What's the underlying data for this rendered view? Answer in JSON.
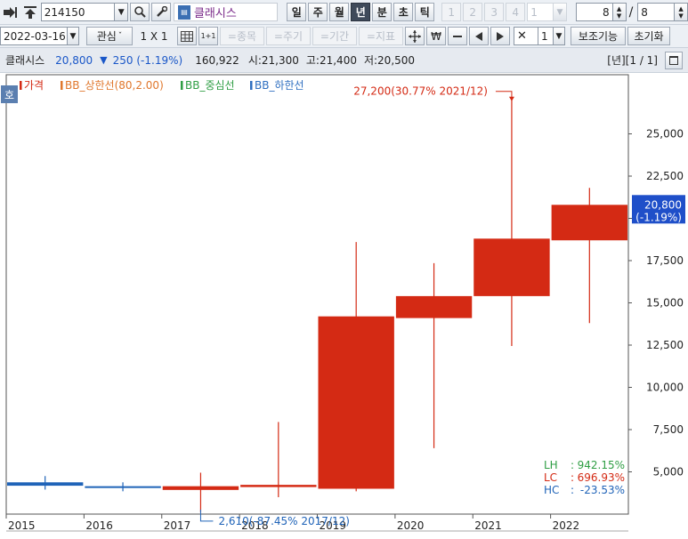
{
  "toolbar1": {
    "code": "214150",
    "stock_name": "클래시스",
    "periods": [
      "일",
      "주",
      "월",
      "년",
      "분",
      "초",
      "틱"
    ],
    "selected_period": "년",
    "split_numbers": [
      "1",
      "2",
      "3",
      "4"
    ],
    "split_input": "1",
    "page_value": "8",
    "page_separator": "/",
    "page_total": "8"
  },
  "toolbar2": {
    "date": "2022-03-16",
    "interest_label": "관심",
    "layout_label": "1 X 1",
    "grid_small_label": "1+1",
    "item_label": "=종목",
    "cycle_label": "=주기",
    "period_label": "=기간",
    "indicator_label": "=지표",
    "won_label": "₩",
    "count_value": "1",
    "aux_label": "보조기능",
    "reset_label": "초기화"
  },
  "status": {
    "name": "클래시스",
    "price": "20,800",
    "direction": "▼",
    "change": "250 (-1.19%)",
    "volume": "160,922",
    "open": "시:21,300",
    "high": "고:21,400",
    "low": "저:20,500",
    "page_info": "[년][1 / 1]"
  },
  "colors": {
    "up": "#d42a14",
    "down": "#1f63b8",
    "legend_price": "#d42a14",
    "legend_bb_upper": "#e0772c",
    "legend_bb_mid": "#2f9e44",
    "legend_bb_lower": "#2f6fc0",
    "last_price_box": "#1f4fc9"
  },
  "icons": [
    "arrow-in-icon",
    "stack-icon",
    "search-icon",
    "wrench-icon",
    "grid-icon",
    "crosshair-icon",
    "scroll-left-icon",
    "scroll-right-icon",
    "fullscreen-icon"
  ],
  "chart_data": {
    "type": "candlestick",
    "x": [
      "2015",
      "2016",
      "2017",
      "2018",
      "2019",
      "2020",
      "2021",
      "2022"
    ],
    "candles": [
      {
        "x": "2015",
        "open": 4380,
        "high": 4750,
        "low": 3950,
        "close": 4180
      },
      {
        "x": "2016",
        "open": 4150,
        "high": 4380,
        "low": 3850,
        "close": 4070
      },
      {
        "x": "2017",
        "open": 3930,
        "high": 4950,
        "low": 2610,
        "close": 4150
      },
      {
        "x": "2018",
        "open": 4100,
        "high": 7950,
        "low": 3500,
        "close": 4230
      },
      {
        "x": "2019",
        "open": 4000,
        "high": 18600,
        "low": 3850,
        "close": 14200
      },
      {
        "x": "2020",
        "open": 14100,
        "high": 17350,
        "low": 6400,
        "close": 15400
      },
      {
        "x": "2021",
        "open": 15400,
        "high": 27200,
        "low": 12450,
        "close": 18800
      },
      {
        "x": "2022",
        "open": 18700,
        "high": 21800,
        "low": 13800,
        "close": 20800
      }
    ],
    "ylim": [
      2500,
      28500
    ],
    "yticks": [
      "5,000",
      "7,500",
      "10,000",
      "12,500",
      "15,000",
      "17,500",
      "20,000",
      "22,500",
      "25,000"
    ],
    "legend": [
      "가격",
      "BB_상한선(80,2.00)",
      "BB_중심선",
      "BB_하한선"
    ],
    "legend_placement": "top-left",
    "max_annotation": "27,200(30.77% 2021/12)",
    "min_annotation": "2,610(-87.45% 2017/12)",
    "last_price_label": "20,800",
    "last_change_label": "(-1.19%)",
    "stats": [
      {
        "key": "LH",
        "sep": ":",
        "value": "942.15%"
      },
      {
        "key": "LC",
        "sep": ":",
        "value": "696.93%"
      },
      {
        "key": "HC",
        "sep": ":",
        "value": "-23.53%"
      }
    ],
    "side_badge": "호"
  }
}
